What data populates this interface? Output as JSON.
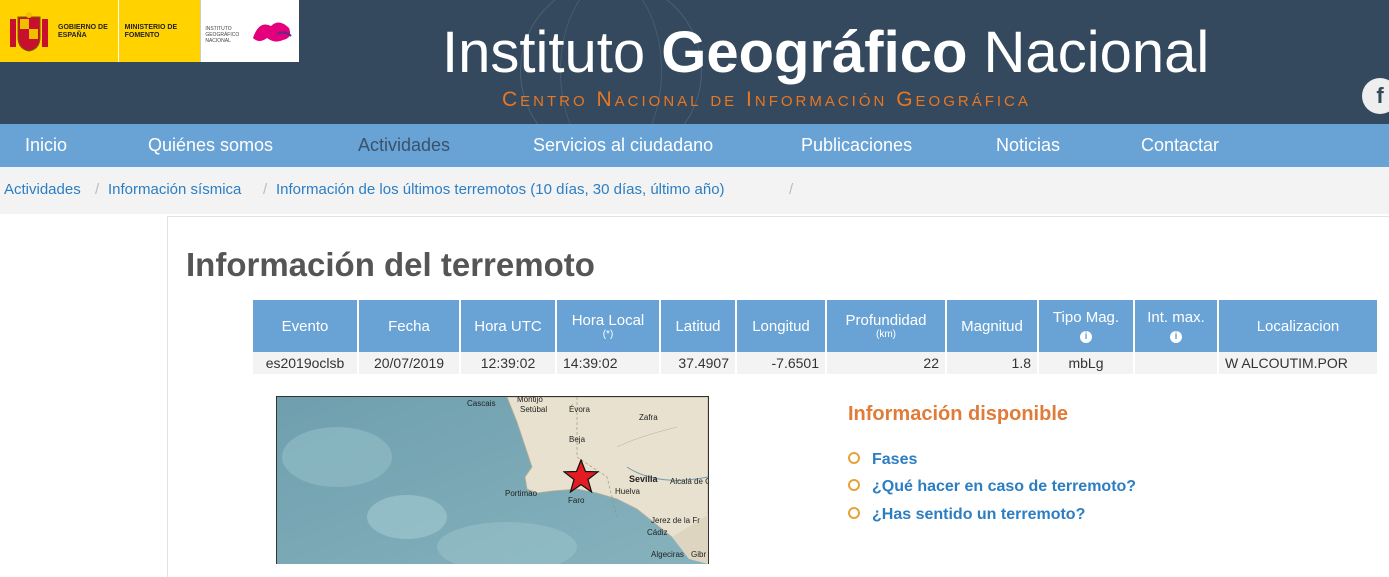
{
  "header": {
    "gov_gobierno": "GOBIERNO DE ESPAÑA",
    "gov_ministerio": "MINISTERIO DE FOMENTO",
    "ign_small": "INSTITUTO GEOGRÁFICO NACIONAL",
    "inst_word1": "Instituto",
    "inst_word2": "Geográfico",
    "inst_word3": "Nacional",
    "subtitle": "Centro Nacional de Información Geográfica",
    "facebook_glyph": "f"
  },
  "nav": {
    "items": [
      "Inicio",
      "Quiénes somos",
      "Actividades",
      "Servicios al ciudadano",
      "Publicaciones",
      "Noticias",
      "Contactar"
    ]
  },
  "breadcrumb": [
    "Actividades",
    "Información sísmica",
    "Información de los últimos terremotos (10 días, 30 días, último año)"
  ],
  "page_title": "Información del terremoto",
  "table": {
    "headers": [
      "Evento",
      "Fecha",
      "Hora UTC",
      "Hora Local",
      "Latitud",
      "Longitud",
      "Profundidad",
      "Magnitud",
      "Tipo Mag.",
      "Int. max.",
      "Localizacion"
    ],
    "hora_local_note": "(*)",
    "profundidad_unit": "(km)",
    "info_glyph": "i",
    "row": [
      "es2019oclsb",
      "20/07/2019",
      "12:39:02",
      "14:39:02",
      "37.4907",
      "-7.6501",
      "22",
      "1.8",
      "mbLg",
      "",
      "W ALCOUTIM.POR"
    ]
  },
  "map": {
    "labels": [
      "Cascais",
      "Montijo",
      "Setúbal",
      "Évora",
      "Zafra",
      "Beja",
      "Sevilla",
      "Alcalá de G",
      "Huelva",
      "Faro",
      "Portimao",
      "Jerez de la Fr",
      "Cádiz",
      "Algeciras",
      "Gibr"
    ],
    "epicenter_color": "#e31b23"
  },
  "info": {
    "heading": "Información disponible",
    "links": [
      "Fases",
      "¿Qué hacer en caso de terremoto?",
      "¿Has sentido un terremoto?"
    ]
  }
}
